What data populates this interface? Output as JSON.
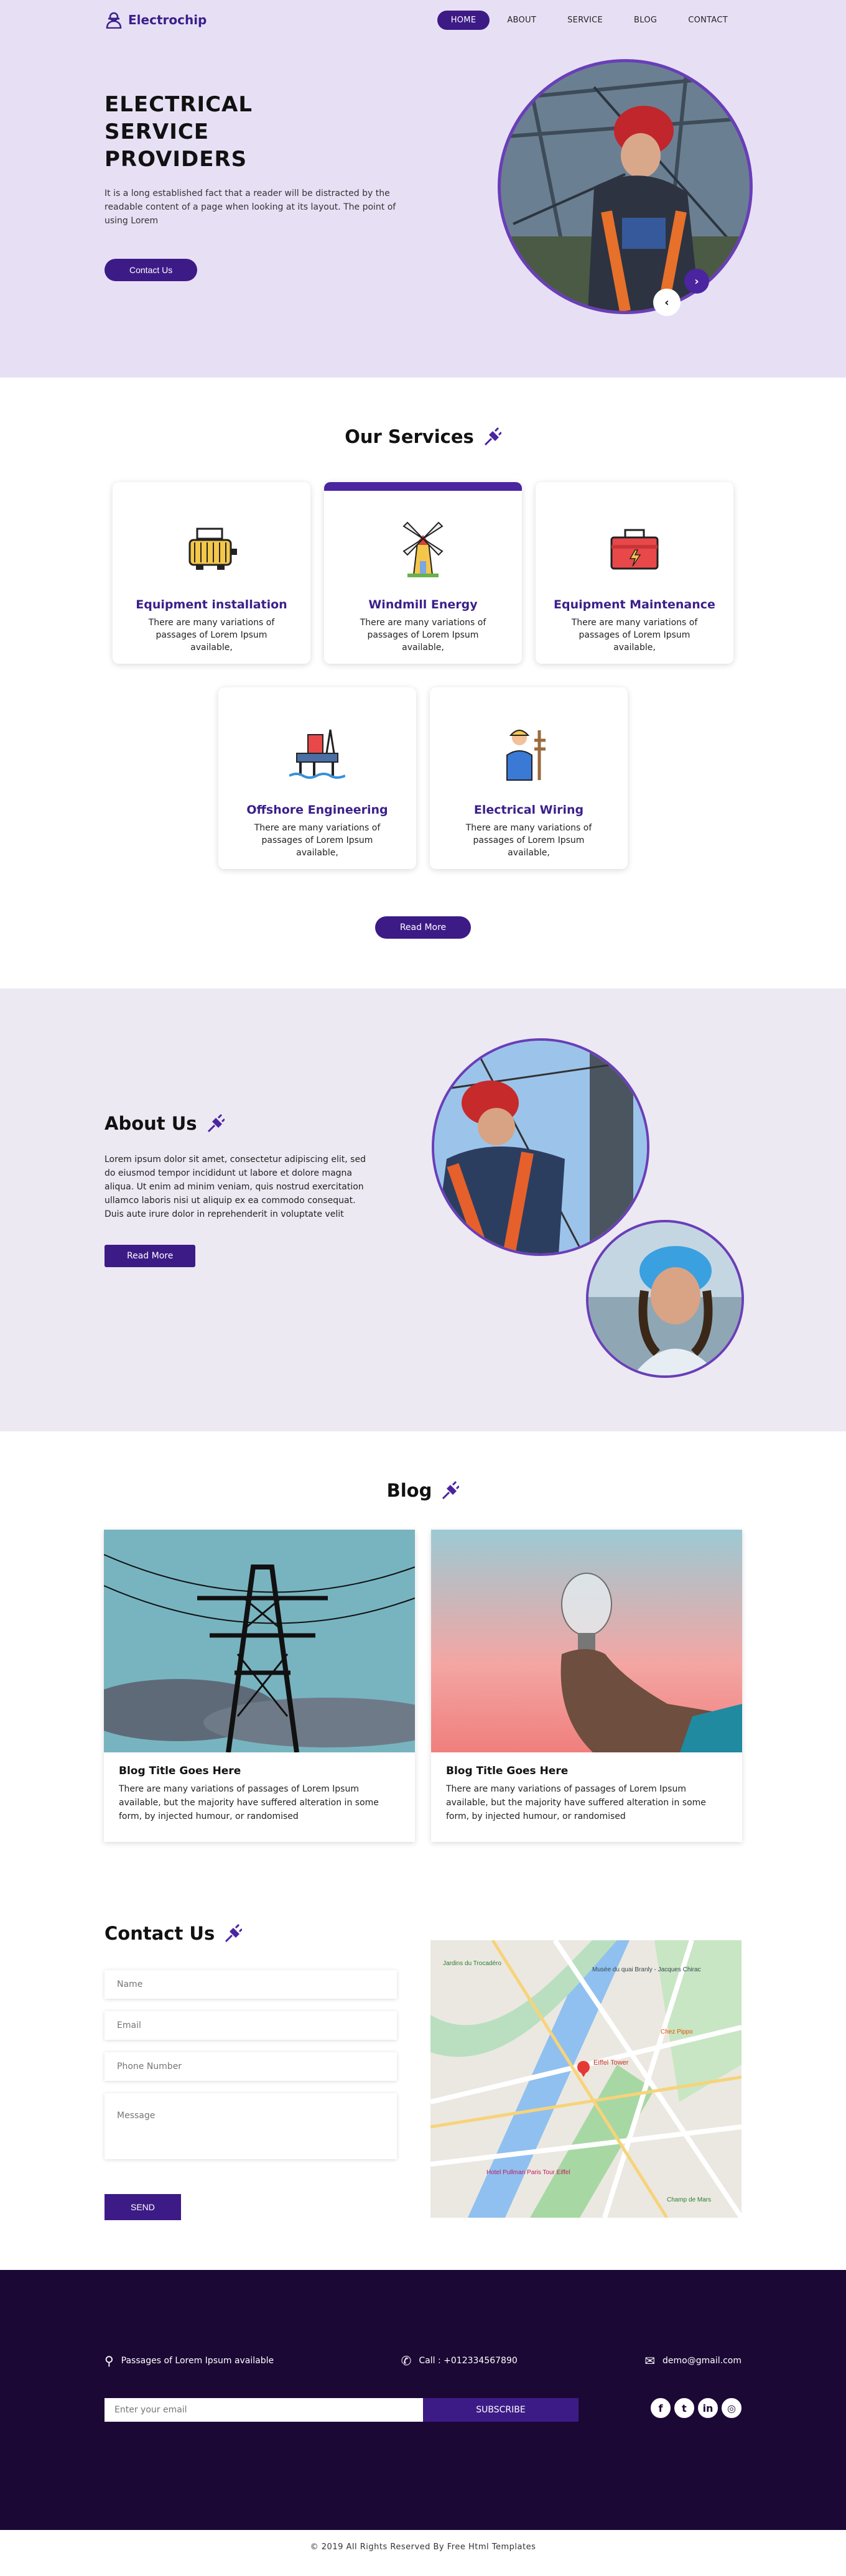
{
  "header": {
    "logo": "Electrochip",
    "nav": [
      {
        "label": "HOME",
        "active": true
      },
      {
        "label": "ABOUT",
        "active": false
      },
      {
        "label": "SERVICE",
        "active": false
      },
      {
        "label": "BLOG",
        "active": false
      },
      {
        "label": "CONTACT",
        "active": false
      }
    ]
  },
  "hero": {
    "title_line1": "ELECTRICAL",
    "title_line2": "SERVICE",
    "title_line3": "PROVIDERS",
    "text": "It is a long established fact that a reader will be distracted by the readable content of a page when looking at its layout. The point of using Lorem",
    "button": "Contact Us",
    "prev_icon": "chevron-left-icon",
    "next_icon": "chevron-right-icon"
  },
  "services": {
    "title": "Our Services",
    "items": [
      {
        "title": "Equipment installation",
        "text": "There are many variations of passages of Lorem Ipsum available,",
        "icon": "electric-motor-icon"
      },
      {
        "title": "Windmill Energy",
        "text": "There are many variations of passages of Lorem Ipsum available,",
        "icon": "windmill-icon"
      },
      {
        "title": "Equipment Maintenance",
        "text": "There are many variations of passages of Lorem Ipsum available,",
        "icon": "toolbox-icon"
      },
      {
        "title": "Offshore Engineering",
        "text": "There are many variations of passages of Lorem Ipsum available,",
        "icon": "oil-rig-icon"
      },
      {
        "title": "Electrical Wiring",
        "text": "There are many variations of passages of Lorem Ipsum available,",
        "icon": "electrician-icon"
      }
    ],
    "button": "Read More"
  },
  "about": {
    "title": "About Us",
    "text": "Lorem ipsum dolor sit amet, consectetur adipiscing elit, sed do eiusmod tempor incididunt ut labore et dolore magna aliqua. Ut enim ad minim veniam, quis nostrud exercitation ullamco laboris nisi ut aliquip ex ea commodo consequat. Duis aute irure dolor in reprehenderit in voluptate velit",
    "button": "Read More"
  },
  "blog": {
    "title": "Blog",
    "posts": [
      {
        "title": "Blog Title Goes Here",
        "text": "There are many variations of passages of Lorem Ipsum available, but the majority have suffered alteration in some form, by injected humour, or randomised"
      },
      {
        "title": "Blog Title Goes Here",
        "text": "There are many variations of passages of Lorem Ipsum available, but the majority have suffered alteration in some form, by injected humour, or randomised"
      }
    ]
  },
  "contact": {
    "title": "Contact Us",
    "name_placeholder": "Name",
    "email_placeholder": "Email",
    "phone_placeholder": "Phone Number",
    "message_placeholder": "Message",
    "button": "SEND",
    "map_labels": {
      "place1": "Eiffel Tower",
      "place2": "Jardins du Trocadéro",
      "place3": "Musée du quai Branly - Jacques Chirac",
      "place4": "Hotel Pullman Paris Tour Eiffel",
      "place5": "Champ de Mars",
      "place6": "Chez Pippo"
    }
  },
  "footer": {
    "address": "Passages of Lorem Ipsum available",
    "phone": "Call : +012334567890",
    "email": "demo@gmail.com",
    "subscribe_placeholder": "Enter your email",
    "subscribe_button": "SUBSCRIBE",
    "social": [
      {
        "name": "facebook-icon",
        "glyph": "f"
      },
      {
        "name": "twitter-icon",
        "glyph": "t"
      },
      {
        "name": "linkedin-icon",
        "glyph": "in"
      },
      {
        "name": "instagram-icon",
        "glyph": "◎"
      }
    ],
    "copyright": "© 2019 All Rights Reserved By Free Html Templates"
  },
  "colors": {
    "brand": "#3d1b86",
    "accent": "#6a3eb8",
    "hero_bg": "#e7e0f5",
    "footer_bg": "#1c0835"
  }
}
